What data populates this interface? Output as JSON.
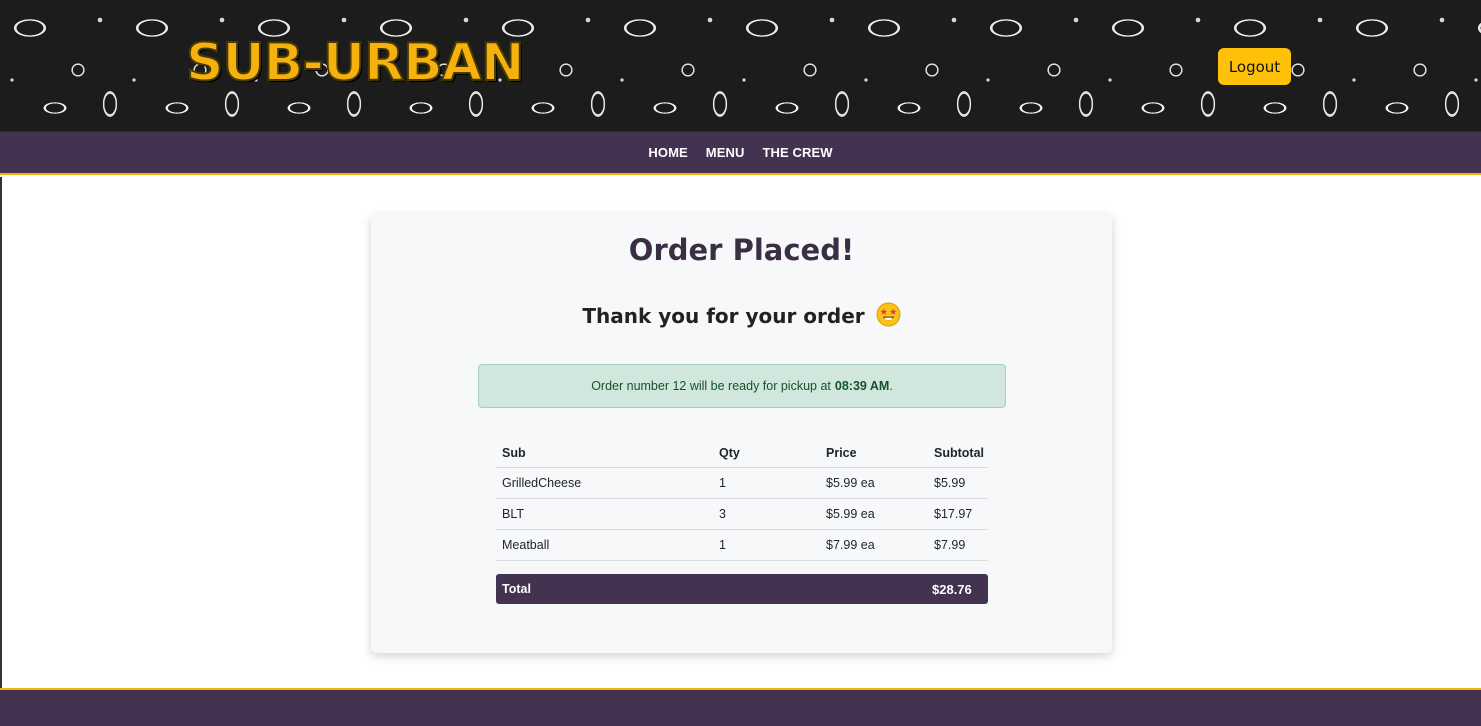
{
  "header": {
    "brand": "SUB-URBAN",
    "logout_label": "Logout"
  },
  "nav": {
    "items": [
      {
        "label": "HOME"
      },
      {
        "label": "MENU"
      },
      {
        "label": "THE CREW"
      }
    ]
  },
  "order": {
    "title": "Order Placed!",
    "thanks": "Thank you for your order",
    "emoji": "star-struck-emoji",
    "alert": {
      "prefix": "Order number 12 will be ready for pickup at",
      "time": "08:39 AM",
      "suffix": "."
    },
    "table": {
      "headers": [
        "Sub",
        "Qty",
        "Price",
        "Subtotal"
      ],
      "rows": [
        [
          "GrilledCheese",
          "1",
          "$5.99 ea",
          "$5.99"
        ],
        [
          "BLT",
          "3",
          "$5.99 ea",
          "$17.97"
        ],
        [
          "Meatball",
          "1",
          "$7.99 ea",
          "$7.99"
        ]
      ],
      "total_label": "Total",
      "total_amount": "$28.76"
    }
  },
  "colors": {
    "brand_yellow": "#f5b20e",
    "nav_purple": "#433350",
    "alert_green_bg": "#d1e7dd",
    "button_yellow": "#ffc107"
  }
}
